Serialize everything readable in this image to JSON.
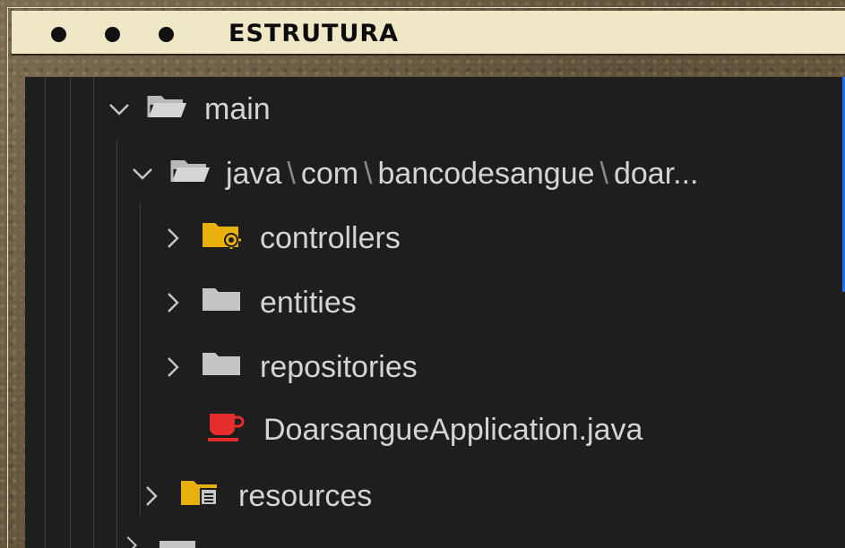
{
  "window": {
    "title": "ESTRUTURA",
    "dots": [
      "",
      "",
      ""
    ]
  },
  "tree": {
    "main": {
      "label": "main",
      "expanded": true,
      "icon": "folder-open-icon"
    },
    "java_path": {
      "parts": [
        "java",
        "com",
        "bancodesangue",
        "doar..."
      ],
      "separator": "\\",
      "expanded": true,
      "icon": "folder-open-icon"
    },
    "controllers": {
      "label": "controllers",
      "expanded": false,
      "icon": "folder-gear-icon"
    },
    "entities": {
      "label": "entities",
      "expanded": false,
      "icon": "folder-icon"
    },
    "repositories": {
      "label": "repositories",
      "expanded": false,
      "icon": "folder-icon"
    },
    "application": {
      "label": "DoarsangueApplication.java",
      "icon": "java-coffee-icon"
    },
    "resources": {
      "label": "resources",
      "expanded": false,
      "icon": "folder-resources-icon"
    }
  },
  "colors": {
    "panel_bg": "#1e1e1e",
    "text": "#d4d4d4",
    "folder_grey": "#c5c5c5",
    "folder_yellow": "#e8b00c",
    "java_red": "#e52d2d",
    "titlebar_bg": "#efe8c6",
    "accent": "#1f6feb"
  }
}
